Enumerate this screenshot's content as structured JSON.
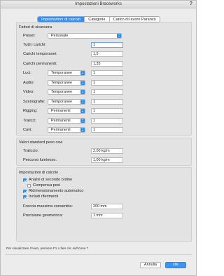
{
  "window": {
    "title": "Impostazioni Braceworks",
    "help": "?"
  },
  "tabs": [
    {
      "label": "Impostazioni di calcolo",
      "active": true
    },
    {
      "label": "Categorie",
      "active": false
    },
    {
      "label": "Carico di lavoro Paranco",
      "active": false
    }
  ],
  "safety_factors": {
    "title": "Fattori di sicurezza",
    "preset": {
      "label": "Preset:",
      "value": "Personale"
    },
    "all_loads": {
      "label": "Tutti i carichi:",
      "value": "1"
    },
    "temporary_loads": {
      "label": "Carichi temporanei:",
      "value": "1,5"
    },
    "permanent_loads": {
      "label": "Carichi permanenti:",
      "value": "1,35"
    },
    "categories": [
      {
        "label": "Luci:",
        "type": "Temporanee",
        "value": "1"
      },
      {
        "label": "Audio:",
        "type": "Temporanee",
        "value": "1"
      },
      {
        "label": "Video:",
        "type": "Temporanee",
        "value": "1"
      },
      {
        "label": "Scenografie:",
        "type": "Temporanee",
        "value": "1"
      },
      {
        "label": "Rigging:",
        "type": "Permanenti",
        "value": "1"
      },
      {
        "label": "Tralicci:",
        "type": "Permanenti",
        "value": "1"
      },
      {
        "label": "Cavi:",
        "type": "Permanenti",
        "value": "1"
      }
    ]
  },
  "cable_weights": {
    "title": "Valori standard peso cavi",
    "truss": {
      "label": "Traliccio:",
      "value": "2,00 kg/m"
    },
    "light_path": {
      "label": "Percorso luminoso:",
      "value": "1,00 kg/m"
    }
  },
  "calc_settings": {
    "title": "Impostazioni di calcolo",
    "options": [
      {
        "label": "Analisi di secondo ordine",
        "checked": true
      },
      {
        "label": "Compensa pesi",
        "checked": false
      },
      {
        "label": "Ridimensionamento automatico",
        "checked": true
      },
      {
        "label": "Includi riferimenti",
        "checked": true
      }
    ],
    "max_deflection": {
      "label": "Freccia massima consentita:",
      "value": "200 mm"
    },
    "geometric_precision": {
      "label": "Precisione geometrica:",
      "value": "1 mm"
    }
  },
  "hint": "Per visualizzare l'Aiuto, premere F1 o fare clic sull'icona ?",
  "buttons": {
    "cancel": "Annulla",
    "ok": "OK"
  }
}
